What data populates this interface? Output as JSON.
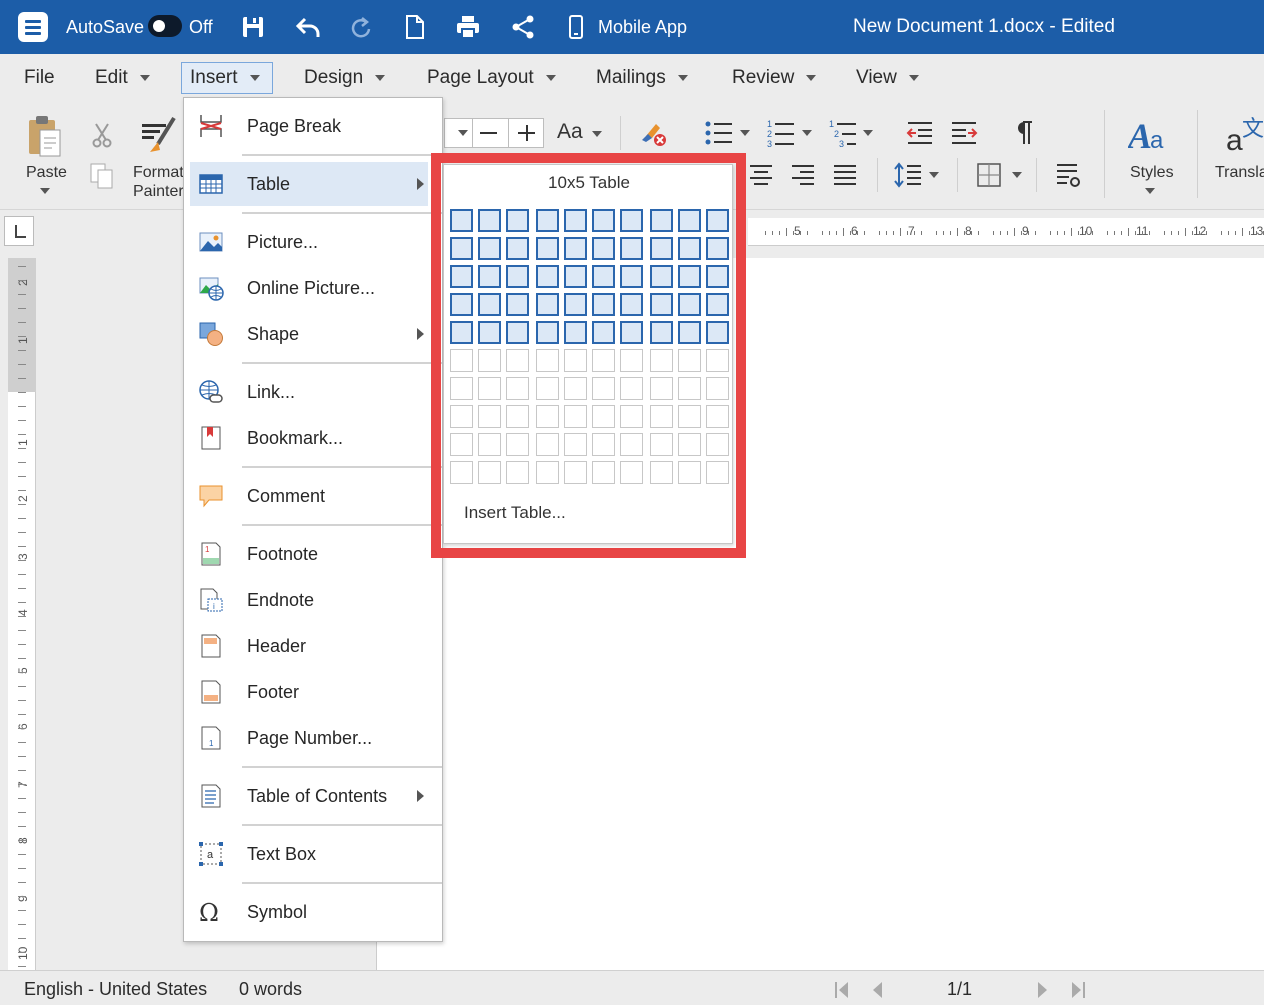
{
  "titlebar": {
    "autosave_label": "AutoSave",
    "autosave_state": "Off",
    "mobile_app_label": "Mobile App",
    "document_title": "New Document 1.docx - Edited"
  },
  "menubar": {
    "items": [
      {
        "label": "File"
      },
      {
        "label": "Edit"
      },
      {
        "label": "Insert"
      },
      {
        "label": "Design"
      },
      {
        "label": "Page Layout"
      },
      {
        "label": "Mailings"
      },
      {
        "label": "Review"
      },
      {
        "label": "View"
      }
    ]
  },
  "ribbon": {
    "paste_label": "Paste",
    "format_painter_label_1": "Format",
    "format_painter_label_2": "Painter",
    "font_case_label": "Aa",
    "styles_label": "Styles",
    "translate_label": "Transla"
  },
  "insert_menu": {
    "items": [
      {
        "label": "Page Break"
      },
      {
        "label": "Table"
      },
      {
        "label": "Picture..."
      },
      {
        "label": "Online Picture..."
      },
      {
        "label": "Shape"
      },
      {
        "label": "Link..."
      },
      {
        "label": "Bookmark..."
      },
      {
        "label": "Comment"
      },
      {
        "label": "Footnote"
      },
      {
        "label": "Endnote"
      },
      {
        "label": "Header"
      },
      {
        "label": "Footer"
      },
      {
        "label": "Page Number..."
      },
      {
        "label": "Table of Contents"
      },
      {
        "label": "Text Box"
      },
      {
        "label": "Symbol"
      }
    ],
    "selected": "Table"
  },
  "table_popup": {
    "title": "10x5 Table",
    "insert_label": "Insert Table...",
    "grid_columns": 10,
    "grid_rows": 10,
    "selected_columns": 10,
    "selected_rows": 5
  },
  "ruler": {
    "h_numbers": [
      "5",
      "6",
      "7",
      "8",
      "9",
      "10",
      "11",
      "12",
      "13"
    ],
    "v_numbers": [
      "2",
      "1",
      "1",
      "2",
      "3",
      "4",
      "5",
      "6",
      "7",
      "8",
      "9",
      "10"
    ]
  },
  "statusbar": {
    "language": "English - United States",
    "word_count": "0 words",
    "page_indicator": "1/1"
  },
  "colors": {
    "titlebar": "#1c5da8",
    "highlight": "#e84545",
    "grid_selected": "#2b66ad"
  }
}
